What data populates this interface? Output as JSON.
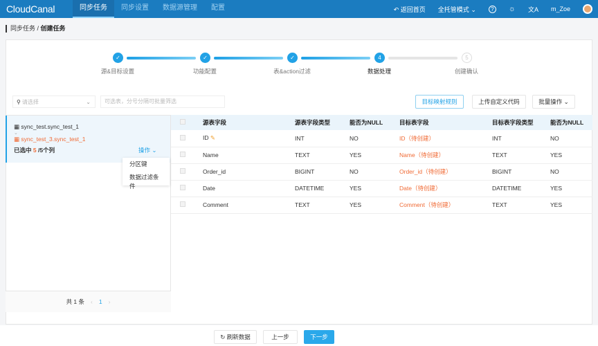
{
  "header": {
    "logo": "CloudCanal",
    "nav": [
      "同步任务",
      "同步设置",
      "数据源管理",
      "配置"
    ],
    "back_home": "返回首页",
    "mode": "全托管模式",
    "user": "m_Zoe"
  },
  "breadcrumb": {
    "parent": "同步任务",
    "current": "创建任务"
  },
  "steps": [
    {
      "label": "源&目标设置",
      "status": "done"
    },
    {
      "label": "功能配置",
      "status": "done"
    },
    {
      "label": "表&action过滤",
      "status": "done"
    },
    {
      "label": "数据处理",
      "status": "current",
      "num": "4"
    },
    {
      "label": "创建确认",
      "status": "pending",
      "num": "5"
    }
  ],
  "toolbar": {
    "select_placeholder": "请选择",
    "filter_placeholder": "可选表，分号分隔可批量筛选",
    "mapping_rule": "目标映射规则",
    "upload_code": "上传自定义代码",
    "batch_ops": "批量操作"
  },
  "left": {
    "source_table": "sync_test.sync_test_1",
    "target_table": "sync_test_3.sync_test_1",
    "selected_prefix": "已选中",
    "selected_count": "5",
    "selected_suffix": "/5个列",
    "ops": "操作",
    "menu": [
      "分区键",
      "数据过滤条件"
    ],
    "total": "共 1 条",
    "page": "1"
  },
  "table": {
    "headers": [
      "源表字段",
      "源表字段类型",
      "能否为NULL",
      "目标表字段",
      "目标表字段类型",
      "能否为NULL"
    ],
    "rows": [
      [
        "ID",
        "INT",
        "NO",
        "ID（待创建）",
        "INT",
        "NO"
      ],
      [
        "Name",
        "TEXT",
        "YES",
        "Name（待创建）",
        "TEXT",
        "YES"
      ],
      [
        "Order_id",
        "BIGINT",
        "NO",
        "Order_id（待创建）",
        "BIGINT",
        "NO"
      ],
      [
        "Date",
        "DATETIME",
        "YES",
        "Date（待创建）",
        "DATETIME",
        "YES"
      ],
      [
        "Comment",
        "TEXT",
        "YES",
        "Comment（待创建）",
        "TEXT",
        "YES"
      ]
    ]
  },
  "footer": {
    "refresh": "刷新数据",
    "prev": "上一步",
    "next": "下一步"
  },
  "colors": {
    "header": "#1b7cc0",
    "accent": "#22a2e6",
    "target_field": "#f06a34"
  }
}
